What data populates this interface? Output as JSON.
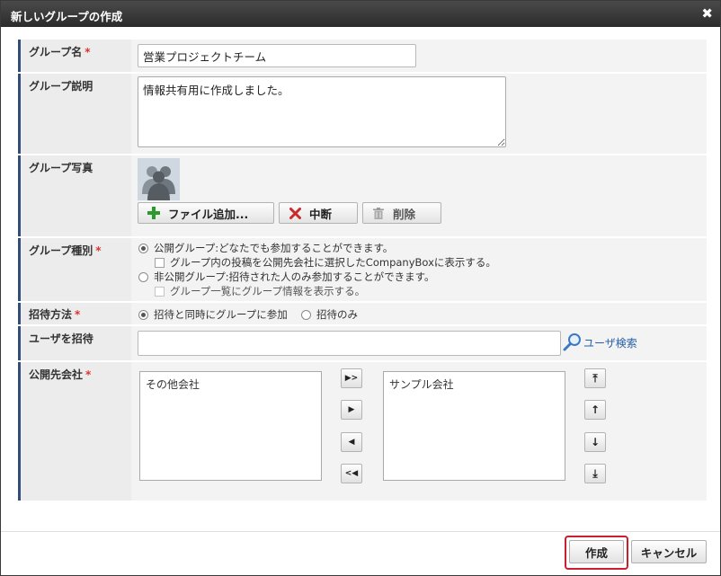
{
  "dialog": {
    "title": "新しいグループの作成",
    "close_glyph": "✖"
  },
  "form": {
    "group_name": {
      "label": "グループ名",
      "required": "*",
      "value": "営業プロジェクトチーム"
    },
    "group_description": {
      "label": "グループ説明",
      "value": "情報共有用に作成しました。"
    },
    "group_photo": {
      "label": "グループ写真",
      "buttons": {
        "add_file": "ファイル追加...",
        "abort": "中断",
        "delete": "削除"
      }
    },
    "group_type": {
      "label": "グループ種別",
      "required": "*",
      "options": [
        {
          "label": "公開グループ:どなたでも参加することができます。",
          "selected": true,
          "sub_checkbox": {
            "label": "グループ内の投稿を公開先会社に選択したCompanyBoxに表示する。",
            "checked": false,
            "disabled": false
          }
        },
        {
          "label": "非公開グループ:招待された人のみ参加することができます。",
          "selected": false,
          "sub_checkbox": {
            "label": "グループ一覧にグループ情報を表示する。",
            "checked": false,
            "disabled": true
          }
        }
      ]
    },
    "invite_method": {
      "label": "招待方法",
      "required": "*",
      "options": [
        {
          "label": "招待と同時にグループに参加",
          "selected": true
        },
        {
          "label": "招待のみ",
          "selected": false
        }
      ]
    },
    "invite_users": {
      "label": "ユーザを招待",
      "value": "",
      "search_link": "ユーザ検索"
    },
    "public_companies": {
      "label": "公開先会社",
      "required": "*",
      "available": [
        "その他会社"
      ],
      "selected": [
        "サンプル会社"
      ],
      "move_buttons": [
        "▶>",
        "▶",
        "◀",
        "<◀"
      ],
      "order_buttons": [
        "⤒",
        "↑",
        "↓",
        "⤓"
      ]
    }
  },
  "footer": {
    "create": "作成",
    "cancel": "キャンセル"
  },
  "colors": {
    "titlebar": "#2b2b2b",
    "label_accent": "#324d7a",
    "required": "#dd3333",
    "link": "#2860a8",
    "highlight": "#cc1f2e"
  }
}
